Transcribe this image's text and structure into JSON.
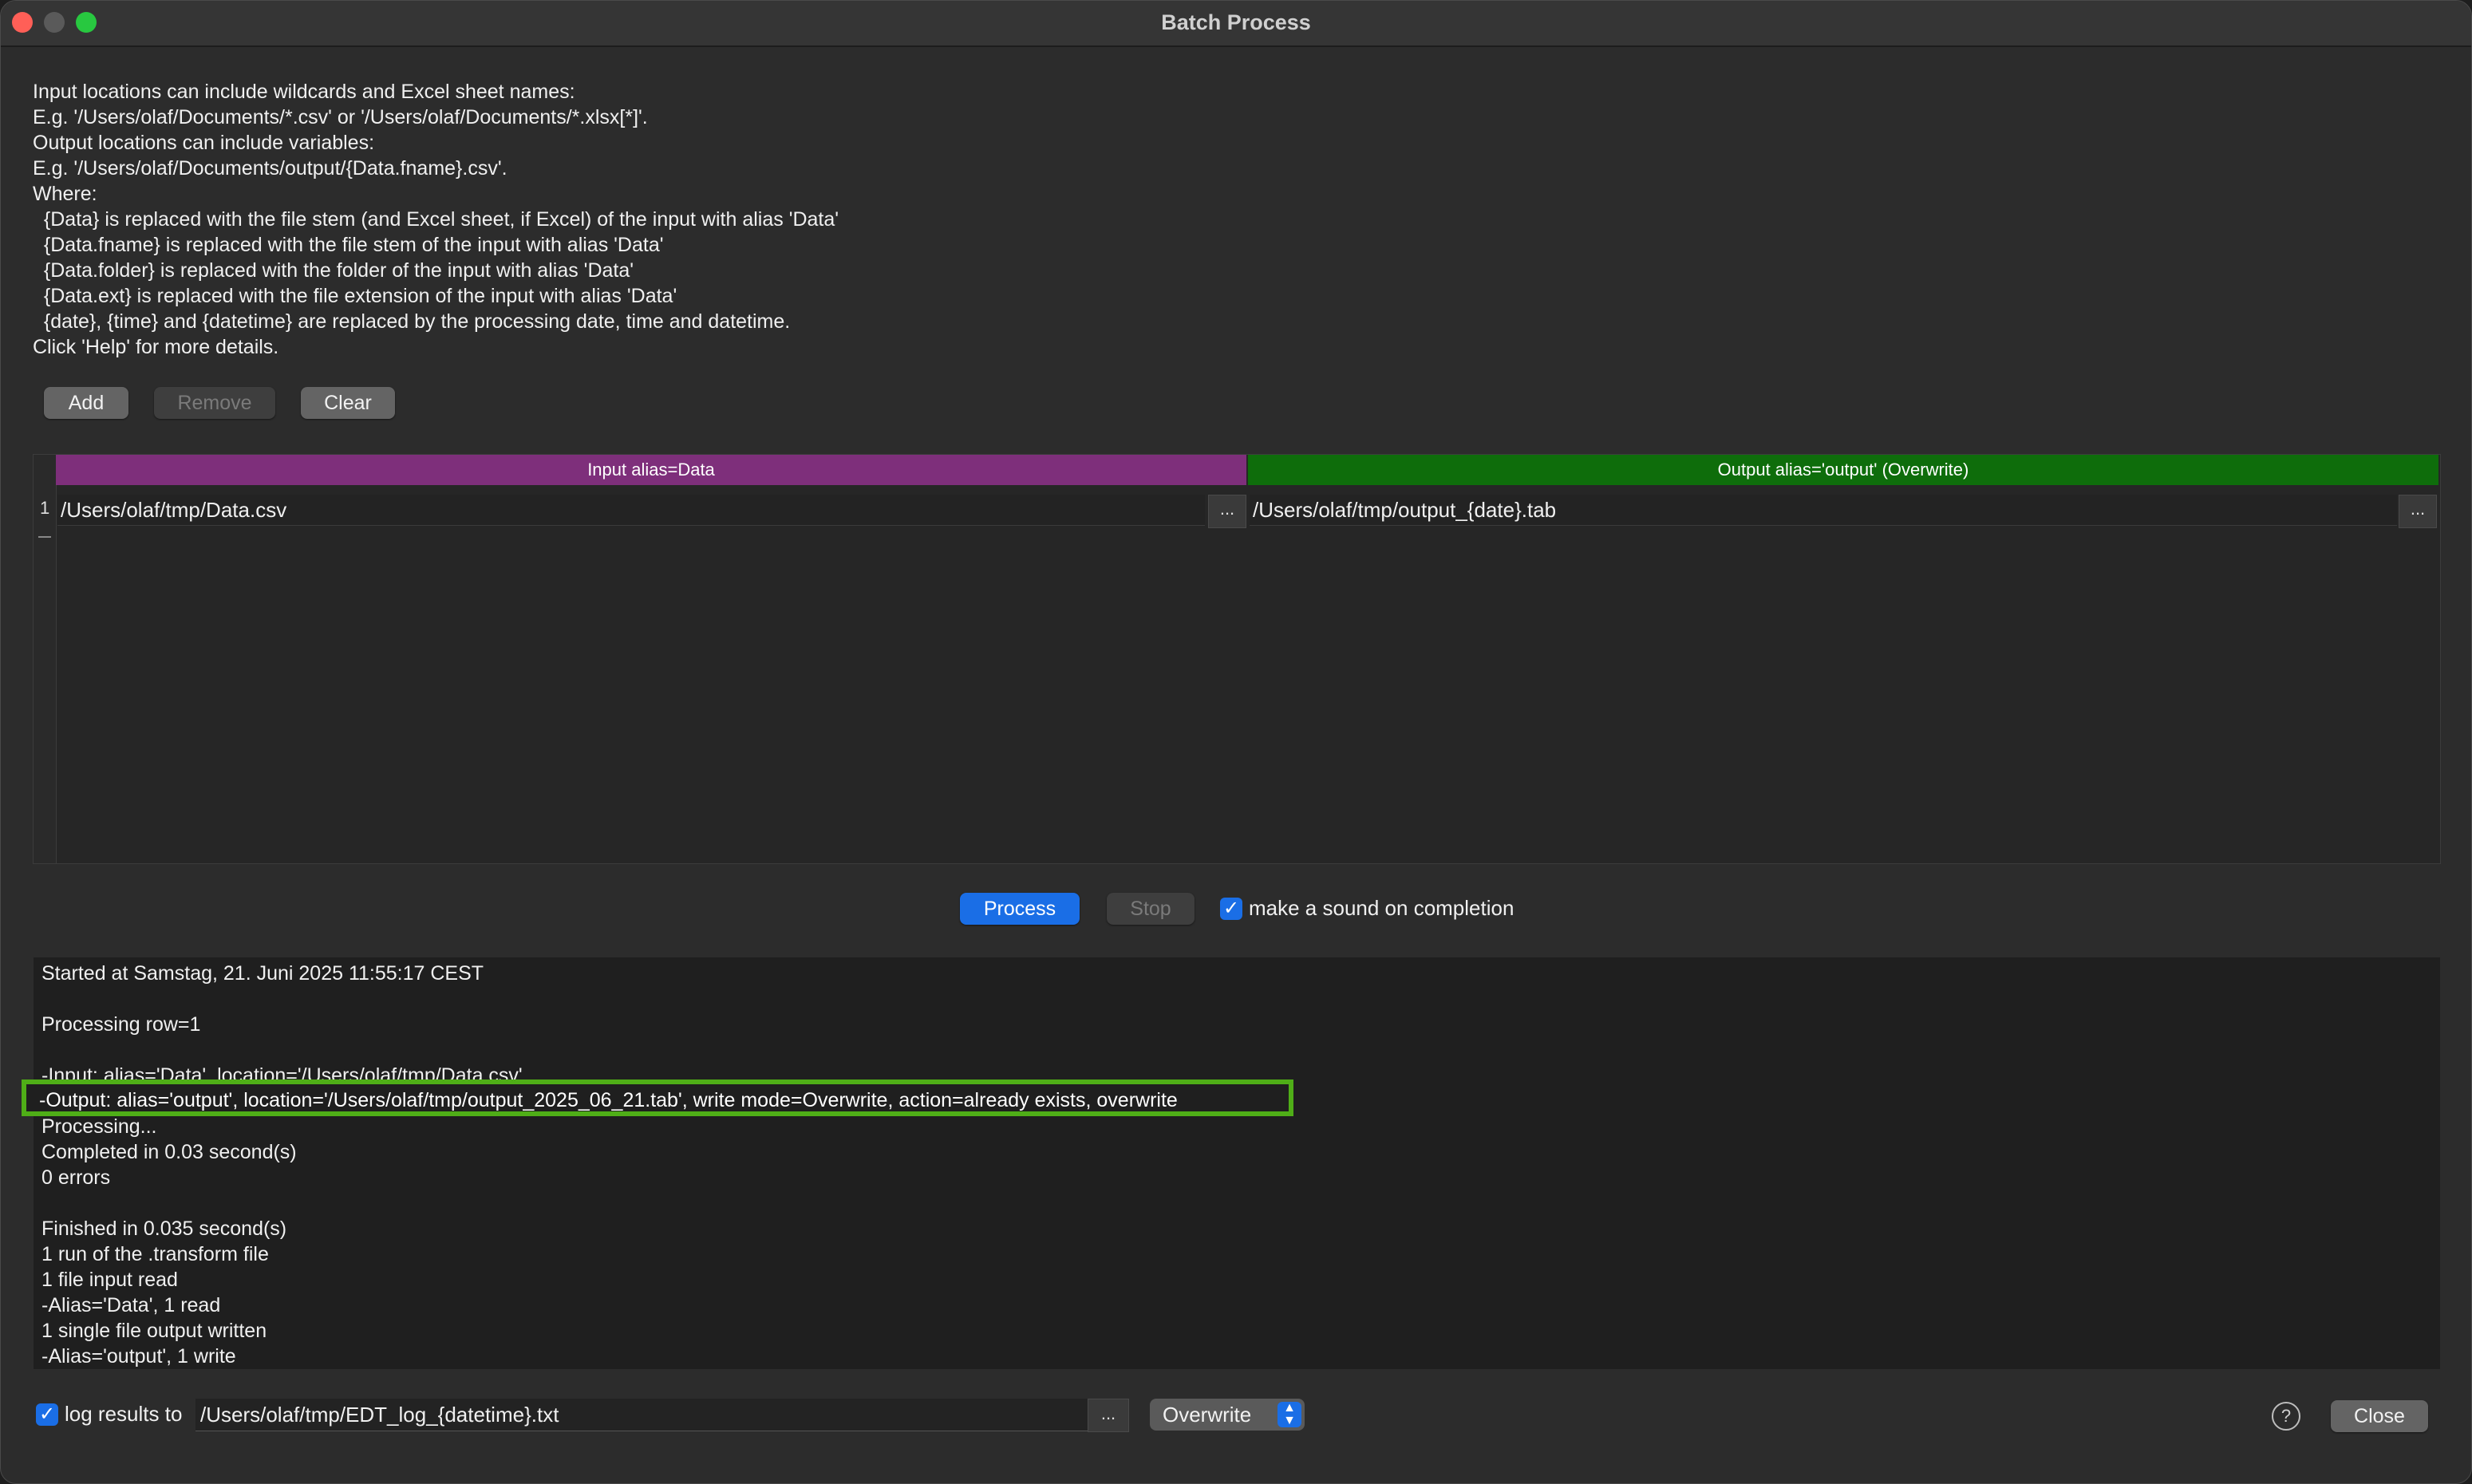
{
  "window": {
    "title": "Batch Process"
  },
  "help_lines": [
    "Input locations can include wildcards and Excel sheet names:",
    "E.g. '/Users/olaf/Documents/*.csv' or '/Users/olaf/Documents/*.xlsx[*]'.",
    "Output locations can include variables:",
    "E.g. '/Users/olaf/Documents/output/{Data.fname}.csv'.",
    "Where:",
    "  {Data} is replaced with the file stem (and Excel sheet, if Excel) of the input with alias 'Data'",
    "  {Data.fname} is replaced with the file stem of the input with alias 'Data'",
    "  {Data.folder} is replaced with the folder of the input with alias 'Data'",
    "  {Data.ext} is replaced with the file extension of the input with alias 'Data'",
    "  {date}, {time} and {datetime} are replaced by the processing date, time and datetime.",
    "Click 'Help' for more details."
  ],
  "toolbar": {
    "add": "Add",
    "remove": "Remove",
    "clear": "Clear"
  },
  "grid": {
    "input_header": "Input alias=Data",
    "output_header": "Output alias='output' (Overwrite)",
    "row_number": "1",
    "input_path": "/Users/olaf/tmp/Data.csv",
    "output_path": "/Users/olaf/tmp/output_{date}.tab",
    "browse": "..."
  },
  "controls": {
    "process": "Process",
    "stop": "Stop",
    "sound_label": "make a sound on completion",
    "sound_checked": true
  },
  "log": {
    "lines": [
      "Started at Samstag, 21. Juni 2025 11:55:17 CEST",
      "",
      "Processing row=1",
      "",
      "-Input: alias='Data', location='/Users/olaf/tmp/Data.csv'",
      "",
      "Processing...",
      "Completed in 0.03 second(s)",
      "0 errors",
      "",
      "Finished in 0.035 second(s)",
      "1 run of the .transform file",
      "1 file input read",
      "-Alias='Data', 1 read",
      "1 single file output written",
      "-Alias='output', 1 write"
    ],
    "highlighted_line": "-Output: alias='output', location='/Users/olaf/tmp/output_2025_06_21.tab', write mode=Overwrite, action=already exists, overwrite",
    "highlight_color": "#4fae17"
  },
  "footer": {
    "log_label": "log results to",
    "log_path": "/Users/olaf/tmp/EDT_log_{datetime}.txt",
    "browse": "...",
    "mode": "Overwrite",
    "help": "?",
    "close": "Close"
  },
  "colors": {
    "input_header": "#7e2f7b",
    "output_header": "#0e6d0b",
    "accent": "#1a6ee6"
  }
}
